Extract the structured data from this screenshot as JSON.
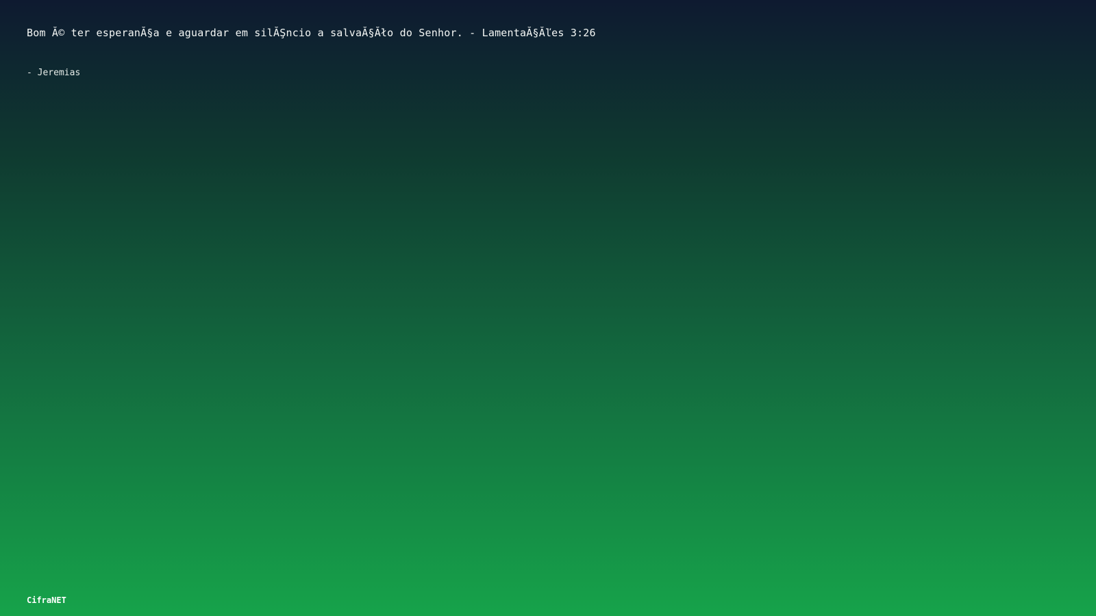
{
  "quote": {
    "text": "Bom Ă© ter esperanĂ§a e aguardar em silĂŞncio a salvaĂ§Ăło do Senhor. - LamentaĂ§Ăľes 3:26",
    "author": "- Jeremias"
  },
  "brand": {
    "name": "CifraNET"
  },
  "colors": {
    "gradient_top": "#0e1a30",
    "gradient_mid": "#136b3f",
    "gradient_bottom": "#16a34a",
    "text": "#ffffff"
  }
}
